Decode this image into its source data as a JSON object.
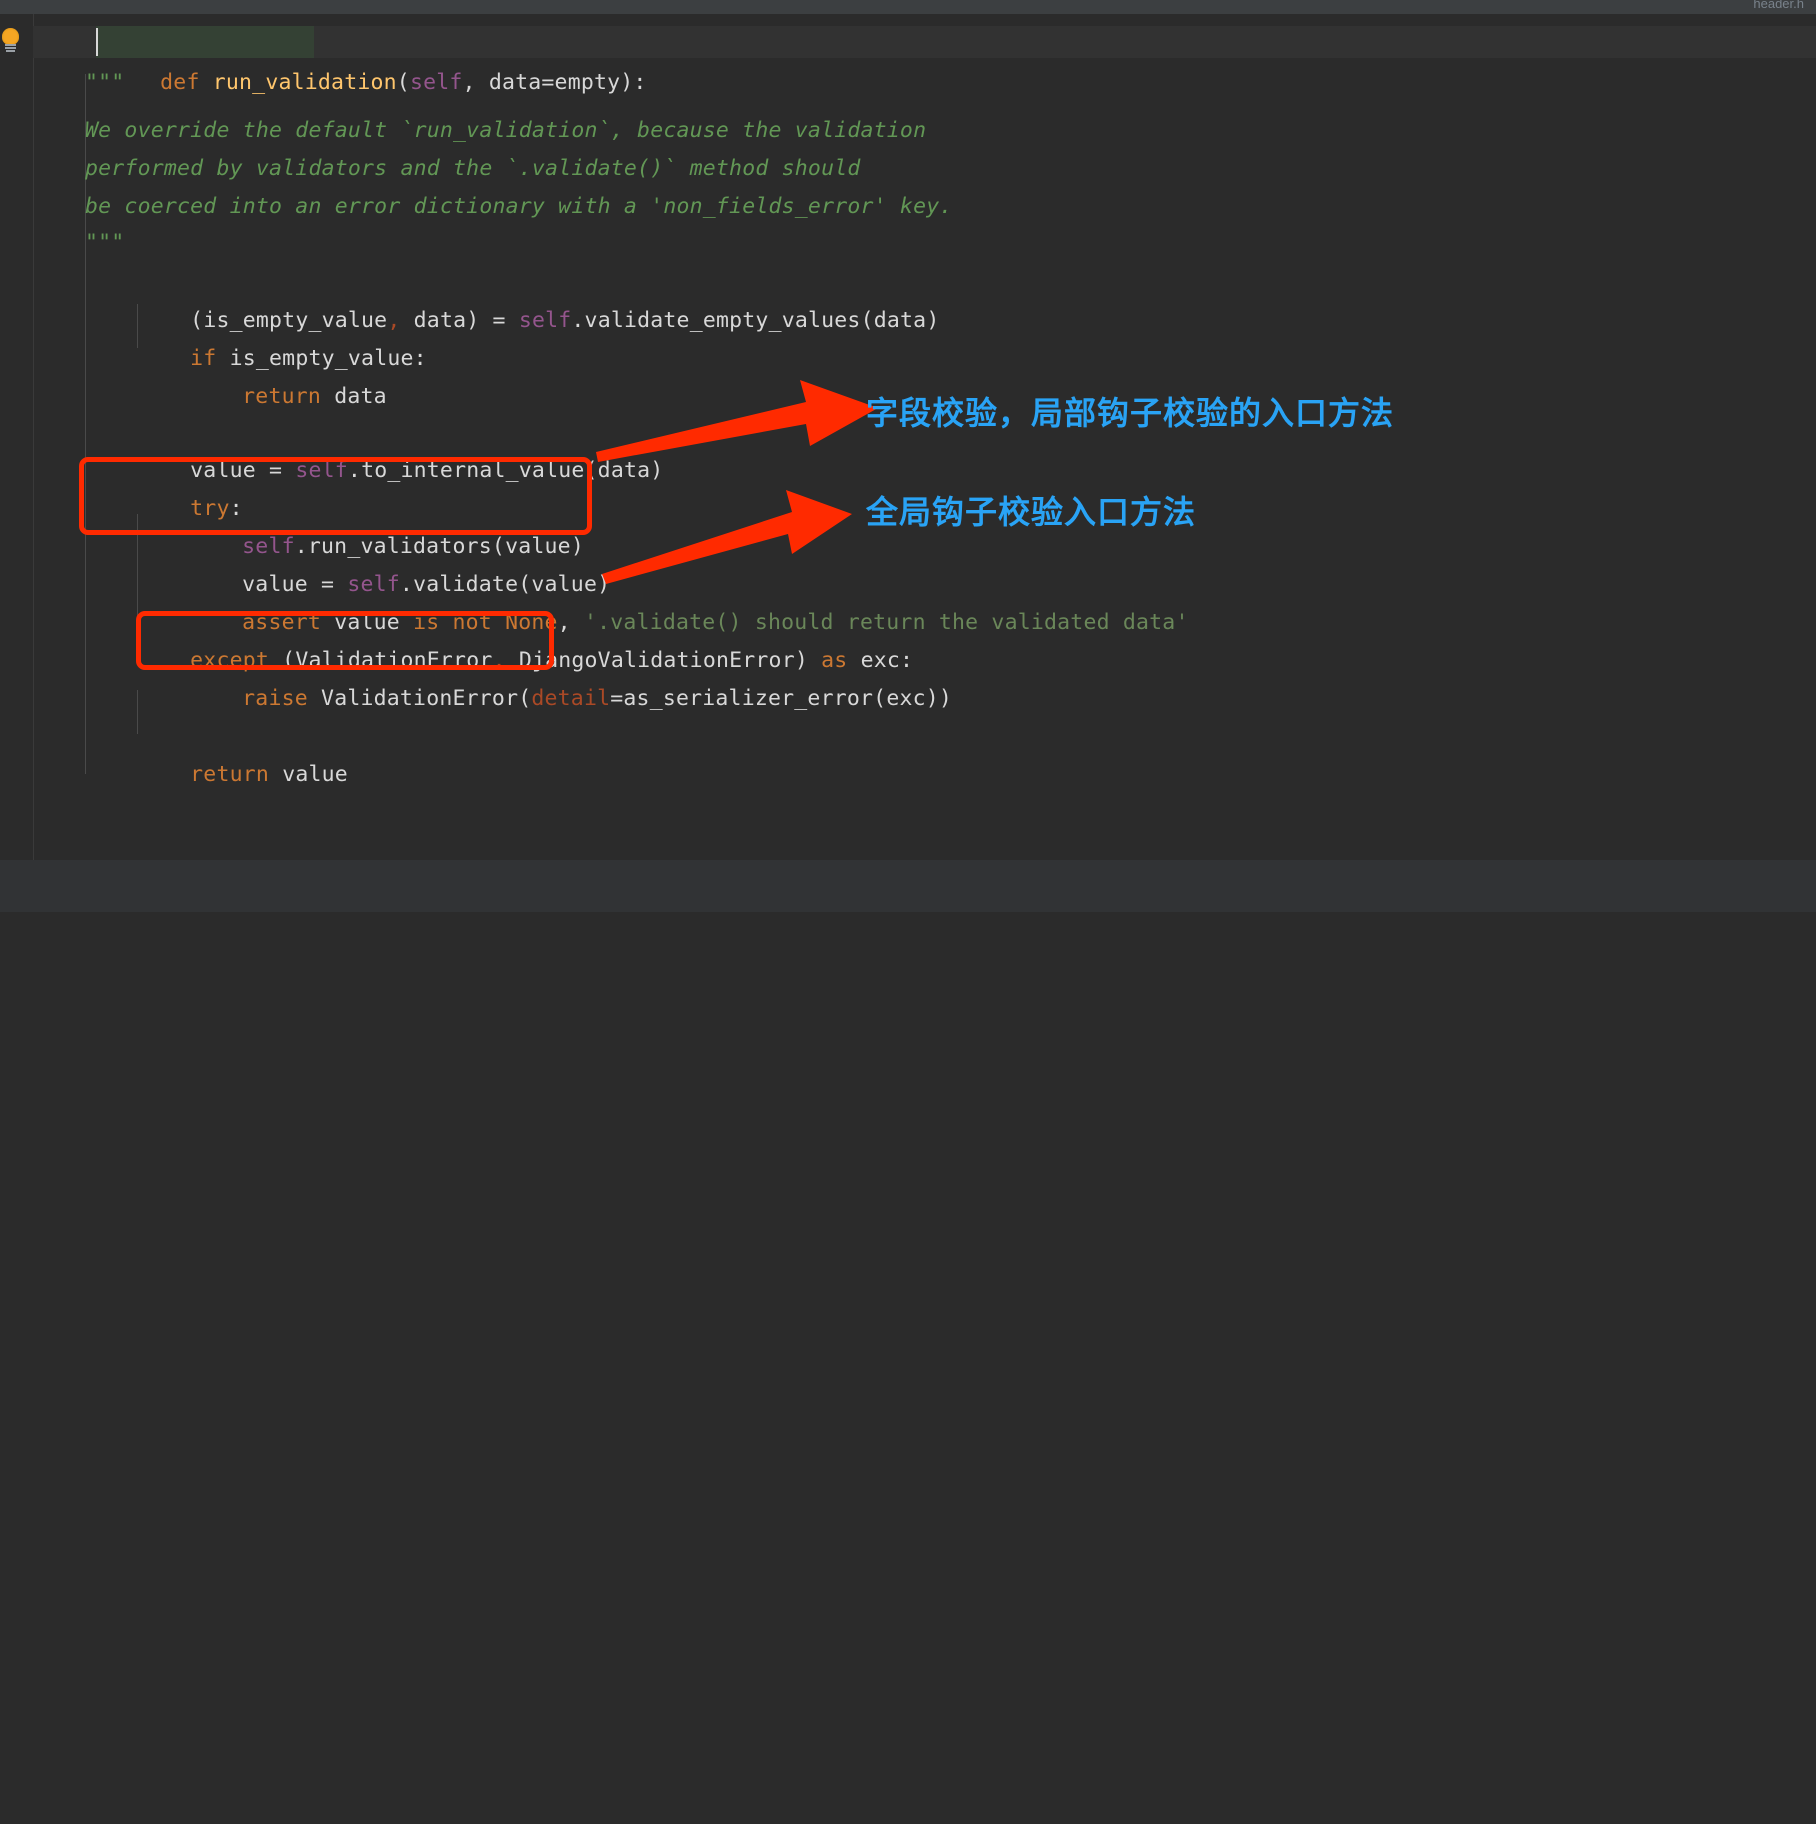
{
  "window": {
    "top_cut_label": "header.h",
    "background": "#2b2b2b",
    "accent_red": "#ff2a00",
    "accent_blue": "#29a3f5"
  },
  "gutter": {
    "bulb_icon": "lightbulb-icon"
  },
  "editor": {
    "language": "Python",
    "lines": [
      {
        "id": "l1",
        "indent": 0,
        "text": "def run_validation(self, data=empty):"
      },
      {
        "id": "l2",
        "indent": 1,
        "text": "\"\"\""
      },
      {
        "id": "l3",
        "indent": 1,
        "text": "We override the default `run_validation`, because the validation"
      },
      {
        "id": "l4",
        "indent": 1,
        "text": "performed by validators and the `.validate()` method should"
      },
      {
        "id": "l5",
        "indent": 1,
        "text": "be coerced into an error dictionary with a 'non_fields_error' key."
      },
      {
        "id": "l6",
        "indent": 1,
        "text": "\"\"\""
      },
      {
        "id": "l7",
        "indent": 1,
        "text": "(is_empty_value, data) = self.validate_empty_values(data)"
      },
      {
        "id": "l8",
        "indent": 1,
        "text": "if is_empty_value:"
      },
      {
        "id": "l9",
        "indent": 2,
        "text": "return data"
      },
      {
        "id": "l10",
        "indent": 1,
        "text": ""
      },
      {
        "id": "l11",
        "indent": 1,
        "text": "value = self.to_internal_value(data)"
      },
      {
        "id": "l12",
        "indent": 1,
        "text": "try:"
      },
      {
        "id": "l13",
        "indent": 2,
        "text": "self.run_validators(value)"
      },
      {
        "id": "l14",
        "indent": 2,
        "text": "value = self.validate(value)"
      },
      {
        "id": "l15",
        "indent": 2,
        "text": "assert value is not None, '.validate() should return the validated data'"
      },
      {
        "id": "l16",
        "indent": 1,
        "text": "except (ValidationError, DjangoValidationError) as exc:"
      },
      {
        "id": "l17",
        "indent": 2,
        "text": "raise ValidationError(detail=as_serializer_error(exc))"
      },
      {
        "id": "l18",
        "indent": 1,
        "text": ""
      },
      {
        "id": "l19",
        "indent": 1,
        "text": "return value"
      }
    ],
    "caret_line": "l1",
    "highlighted_identifier": "run_validation"
  },
  "annotations": {
    "boxes": [
      {
        "id": "redbox-1",
        "targets_line": "l11",
        "color": "#ff2a00"
      },
      {
        "id": "redbox-2",
        "targets_line": "l14",
        "color": "#ff2a00"
      }
    ],
    "arrows": [
      {
        "id": "arrow-1",
        "from_box": "redbox-1",
        "to_label": "cn-1",
        "color": "#ff2a00"
      },
      {
        "id": "arrow-2",
        "from_box": "redbox-2",
        "to_label": "cn-2",
        "color": "#ff2a00"
      }
    ],
    "labels": [
      {
        "id": "cn-1",
        "text": "字段校验，局部钩子校验的入口方法",
        "color": "#29a3f5"
      },
      {
        "id": "cn-2",
        "text": "全局钩子校验入口方法",
        "color": "#29a3f5"
      }
    ]
  }
}
